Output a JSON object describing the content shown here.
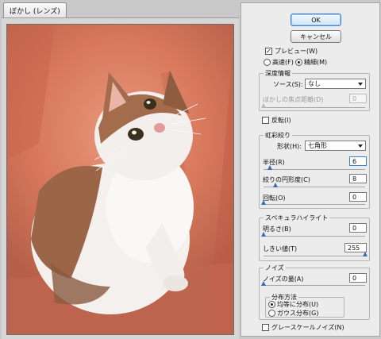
{
  "window": {
    "title": "ぼかし (レンズ)"
  },
  "buttons": {
    "ok": "OK",
    "cancel": "キャンセル"
  },
  "preview_option": {
    "label": "プレビュー(W)",
    "checked": true
  },
  "quality": {
    "faster": "高速(F)",
    "more_accurate": "精細(M)",
    "selected": "more_accurate"
  },
  "depth_map": {
    "title": "深度情報",
    "source_label": "ソース(S):",
    "source_value": "なし",
    "focal_label": "ぼかしの焦点距離(D)",
    "focal_value": "0",
    "invert_label": "反転(I)"
  },
  "iris": {
    "title": "虹彩絞り",
    "shape_label": "形状(H):",
    "shape_value": "七角形",
    "radius_label": "半径(R)",
    "radius_value": "6",
    "curvature_label": "絞りの円形度(C)",
    "curvature_value": "8",
    "rotation_label": "回転(O)",
    "rotation_value": "0"
  },
  "specular": {
    "title": "スペキュラハイライト",
    "brightness_label": "明るさ(B)",
    "brightness_value": "0",
    "threshold_label": "しきい値(T)",
    "threshold_value": "255"
  },
  "noise": {
    "title": "ノイズ",
    "amount_label": "ノイズの量(A)",
    "amount_value": "0",
    "distribution_title": "分布方法",
    "uniform": "均等に分布(U)",
    "gaussian": "ガウス分布(G)",
    "selected": "uniform",
    "monochrome_label": "グレースケールノイズ(N)"
  },
  "colors": {
    "background": "#d87c60",
    "accent": "#3b7fd0"
  }
}
